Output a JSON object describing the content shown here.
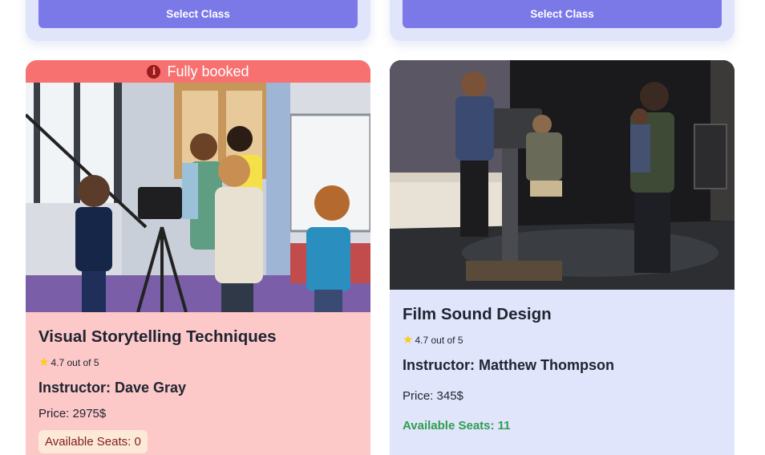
{
  "top_cards": [
    {
      "button_label": "Select Class"
    },
    {
      "button_label": "Select Class"
    }
  ],
  "classes": [
    {
      "banner": "Fully booked",
      "banner_icon": "info-icon",
      "title": "Visual Storytelling Techniques",
      "rating_text": "4.7 out of 5",
      "rating_icon": "star-icon",
      "instructor": "Instructor: Dave Gray",
      "price": "Price: 2975$",
      "seats": "Available Seats: 0",
      "card_color": "#fcc8c8",
      "banner_color": "#f87171"
    },
    {
      "title": "Film Sound Design",
      "rating_text": "4.7 out of 5",
      "rating_icon": "star-icon",
      "instructor": "Instructor: Matthew Thompson",
      "price": "Price: 345$",
      "seats": "Available Seats: 11",
      "card_color": "#e0e5fb",
      "seats_color": "#2f9e4e"
    }
  ],
  "colors": {
    "select_button": "#7b78e8",
    "star": "#facc15"
  }
}
